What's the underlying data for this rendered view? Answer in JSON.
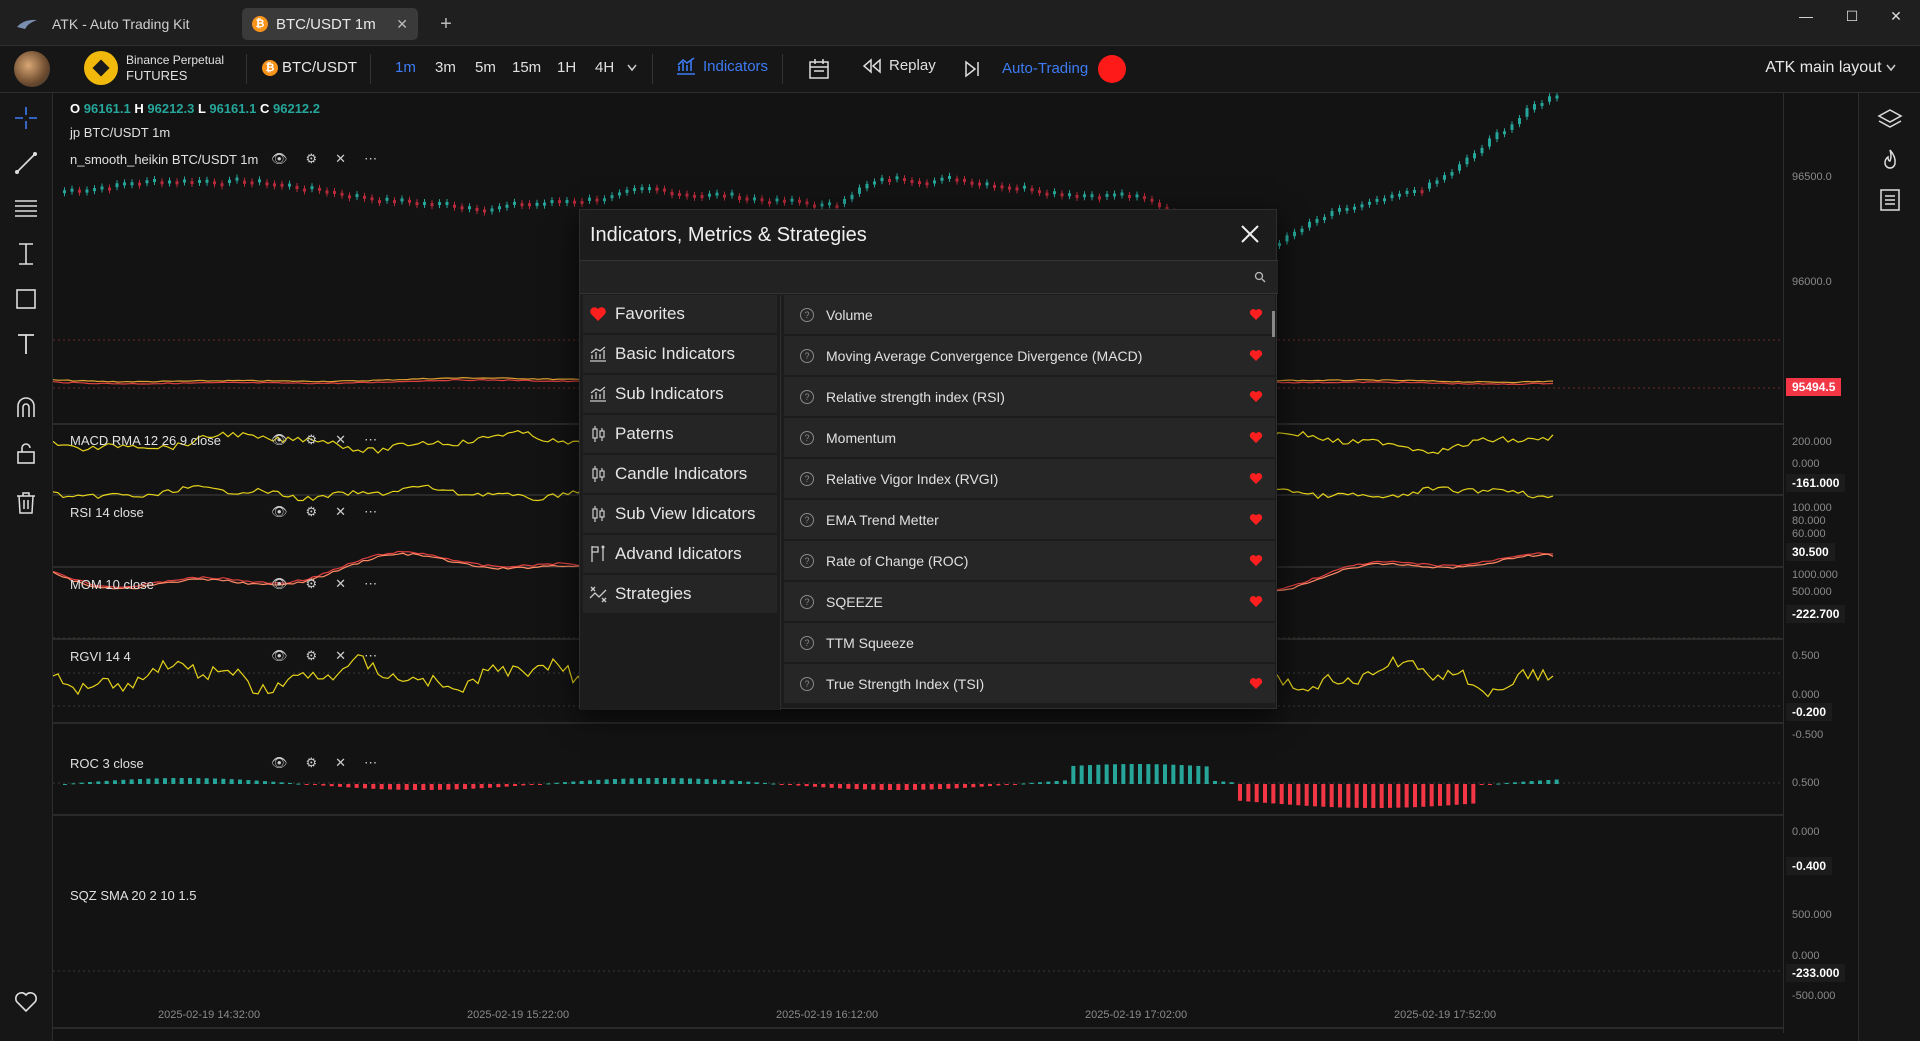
{
  "titlebar": {
    "app_title": "ATK - Auto Trading Kit",
    "tab_title": "BTC/USDT 1m",
    "tab_coin_glyph": "₿",
    "new_tab": "+",
    "close_tab": "✕",
    "win_min": "—",
    "win_max": "☐",
    "win_close": "✕"
  },
  "toolbar": {
    "exchange_name": "Binance Perpetual",
    "exchange_type": "FUTURES",
    "symbol": "BTC/USDT",
    "timeframes": [
      "1m",
      "3m",
      "5m",
      "15m",
      "1H",
      "4H"
    ],
    "active_timeframe": "1m",
    "indicators": "Indicators",
    "replay": "Replay",
    "auto_trading": "Auto-Trading",
    "layout": "ATK main layout"
  },
  "ohlc": {
    "o_label": "O",
    "o": "96161.1",
    "h_label": "H",
    "h": "96212.3",
    "l_label": "L",
    "l": "96161.1",
    "c_label": "C",
    "c": "96212.2"
  },
  "panes": {
    "main_symbol": "jp BTC/USDT 1m",
    "main_indicator": "n_smooth_heikin BTC/USDT 1m",
    "macd": "MACD RMA 12 26 9 close",
    "rsi": "RSI 14 close",
    "mom": "MOM 10 close",
    "rgvi": "RGVI 14 4",
    "roc": "ROC 3 close",
    "sqz": "SQZ SMA 20 2 10 1.5"
  },
  "price_axis": {
    "main_ticks": [
      "96500.0",
      "96000.0"
    ],
    "main_last": "95494.5",
    "macd_ticks": [
      "200.000",
      "0.000"
    ],
    "macd_last": "-161.000",
    "rsi_ticks": [
      "100.000",
      "80.000",
      "60.000"
    ],
    "rsi_last": "30.500",
    "mom_ticks": [
      "1000.000",
      "500.000"
    ],
    "mom_last": "-222.700",
    "rgvi_ticks": [
      "0.500",
      "0.000",
      "-0.500"
    ],
    "rgvi_last": "-0.200",
    "roc_ticks": [
      "0.500",
      "0.000"
    ],
    "roc_last": "-0.400",
    "sqz_ticks": [
      "500.000",
      "0.000",
      "-500.000"
    ],
    "sqz_last": "-233.000"
  },
  "time_axis": [
    "2025-02-19 14:32:00",
    "2025-02-19 15:22:00",
    "2025-02-19 16:12:00",
    "2025-02-19 17:02:00",
    "2025-02-19 17:52:00"
  ],
  "modal": {
    "title": "Indicators, Metrics & Strategies",
    "search_placeholder": "",
    "categories": [
      "Favorites",
      "Basic Indicators",
      "Sub Indicators",
      "Paterns",
      "Candle Indicators",
      "Sub View Idicators",
      "Advand Idicators",
      "Strategies"
    ],
    "items": [
      {
        "name": "Volume",
        "favorite": true
      },
      {
        "name": "Moving Average Convergence Divergence (MACD)",
        "favorite": true
      },
      {
        "name": "Relative strength index (RSI)",
        "favorite": true
      },
      {
        "name": "Momentum",
        "favorite": true
      },
      {
        "name": "Relative Vigor Index (RVGI)",
        "favorite": true
      },
      {
        "name": "EMA Trend Metter",
        "favorite": true
      },
      {
        "name": "Rate of Change (ROC)",
        "favorite": true
      },
      {
        "name": "SQEEZE",
        "favorite": true
      },
      {
        "name": "TTM Squeeze",
        "favorite": false
      },
      {
        "name": "True Strength Index (TSI)",
        "favorite": true
      }
    ]
  },
  "colors": {
    "accent": "#3d7cf5",
    "up": "#26a69a",
    "down": "#f23645",
    "heart": "#ff1f1f"
  }
}
